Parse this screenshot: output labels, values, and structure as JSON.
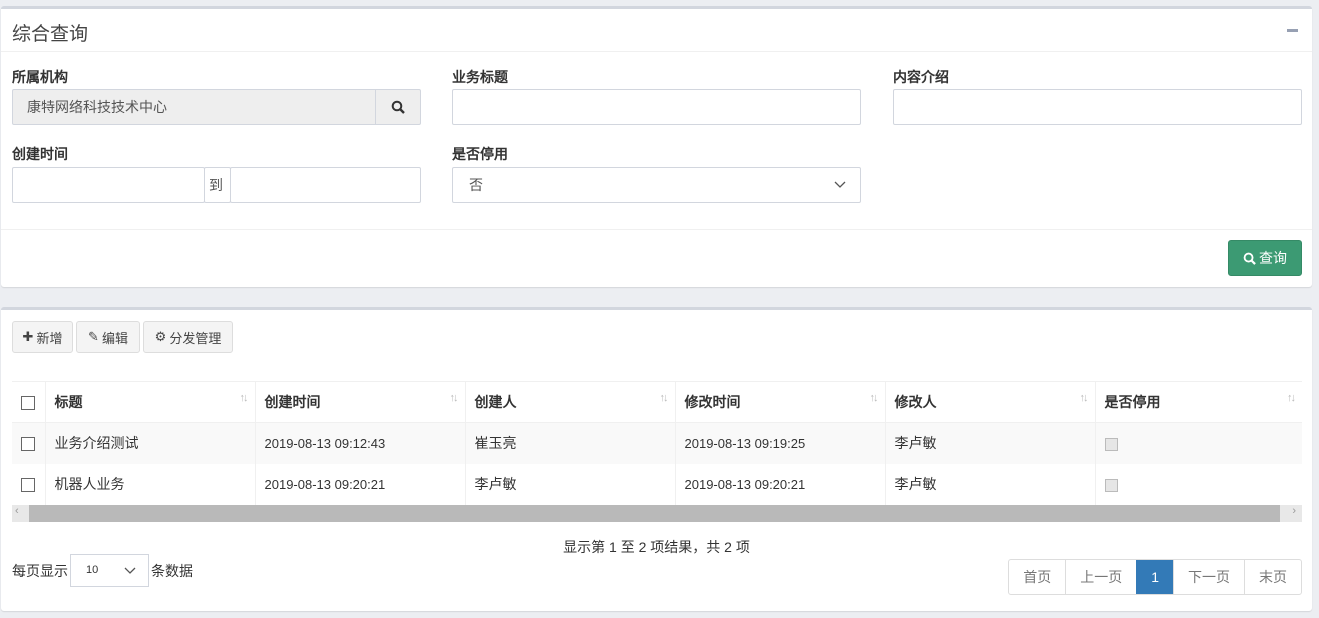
{
  "search_panel": {
    "title": "综合查询",
    "org_label": "所属机构",
    "org_value": "康特网络科技技术中心",
    "title_label": "业务标题",
    "title_value": "",
    "intro_label": "内容介绍",
    "intro_value": "",
    "created_label": "创建时间",
    "range_to": "到",
    "disabled_label": "是否停用",
    "disabled_value": "否",
    "query_button": "查询"
  },
  "toolbar": {
    "add": "新增",
    "edit": "编辑",
    "dist": "分发管理"
  },
  "table": {
    "columns": [
      "标题",
      "创建时间",
      "创建人",
      "修改时间",
      "修改人",
      "是否停用"
    ],
    "rows": [
      {
        "title": "业务介绍测试",
        "created": "2019-08-13 09:12:43",
        "creator": "崔玉亮",
        "modified": "2019-08-13 09:19:25",
        "modifier": "李卢敏",
        "disabled": false
      },
      {
        "title": "机器人业务",
        "created": "2019-08-13 09:20:21",
        "creator": "李卢敏",
        "modified": "2019-08-13 09:20:21",
        "modifier": "李卢敏",
        "disabled": false
      }
    ]
  },
  "footer": {
    "info": "显示第 1 至 2 项结果，共 2 项",
    "per_page_prefix": "每页显示",
    "per_page": "10",
    "per_page_suffix": "条数据",
    "pages": {
      "first": "首页",
      "prev": "上一页",
      "current": "1",
      "next": "下一页",
      "last": "末页"
    }
  },
  "colors": {
    "query_button": "#3c9a73",
    "active_page": "#337ab7"
  }
}
